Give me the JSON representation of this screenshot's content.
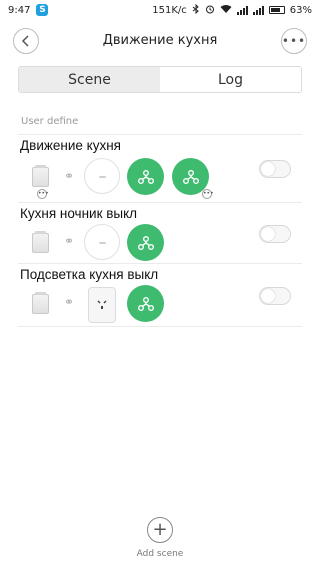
{
  "status_bar": {
    "time": "9:47",
    "network_speed": "151K/c",
    "battery": "63%",
    "app_icon": "skype-icon"
  },
  "header": {
    "title": "Движение кухня",
    "back_icon": "chevron-left-icon",
    "more_icon": "more-horizontal-icon"
  },
  "tabs": [
    {
      "label": "Scene",
      "active": true
    },
    {
      "label": "Log",
      "active": false
    }
  ],
  "section_label": "User define",
  "scenes": [
    {
      "name": "Движение кухня",
      "trigger_device": "motion-sensor",
      "target_device": "gateway",
      "actions": 2,
      "enabled": false
    },
    {
      "name": "Кухня ночник выкл",
      "trigger_device": "motion-sensor",
      "target_device": "gateway",
      "actions": 1,
      "enabled": false
    },
    {
      "name": "Подсветка кухня выкл",
      "trigger_device": "motion-sensor",
      "target_device": "smart-socket",
      "actions": 1,
      "enabled": false
    }
  ],
  "footer": {
    "add_label": "Add scene"
  },
  "colors": {
    "accent_green": "#3fbb6f",
    "active_tab_bg": "#ececec"
  }
}
